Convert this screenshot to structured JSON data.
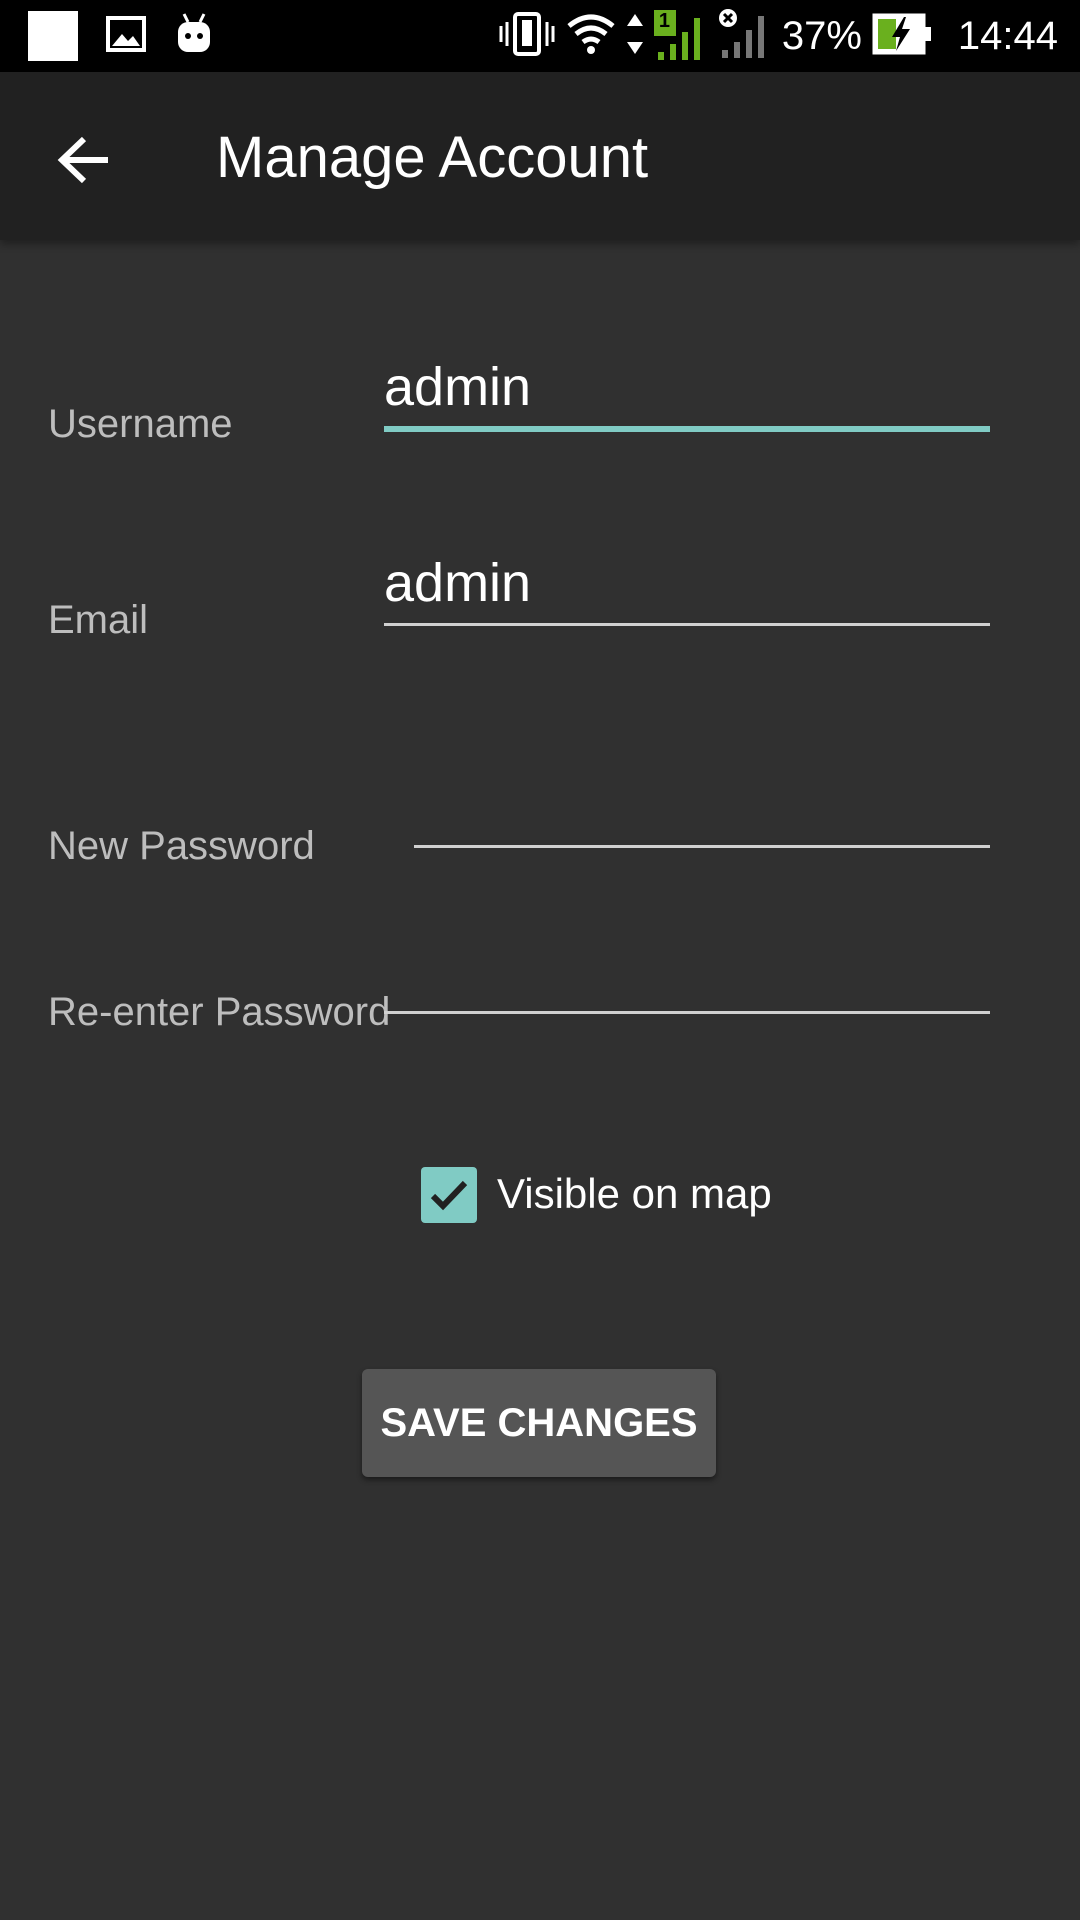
{
  "status_bar": {
    "battery_percent": "37%",
    "time": "14:44",
    "sim_label": "1",
    "icons": [
      "notification-square-icon",
      "image-icon",
      "android-icon",
      "vibrate-icon",
      "wifi-icon",
      "data-arrows-icon",
      "signal-sim1-icon",
      "signal-sim2-icon",
      "battery-charging-icon"
    ],
    "colors": {
      "signal_active": "#6ab01e",
      "battery_charge": "#6ab01e"
    }
  },
  "app_bar": {
    "title": "Manage Account",
    "back_icon": "arrow-back-icon"
  },
  "form": {
    "username": {
      "label": "Username",
      "value": "admin"
    },
    "email": {
      "label": "Email",
      "value": "admin"
    },
    "new_password": {
      "label": "New Password",
      "value": ""
    },
    "reenter_password": {
      "label": "Re-enter Password",
      "value": ""
    },
    "visible_on_map": {
      "label": "Visible on map",
      "checked": true
    },
    "save_button": "SAVE CHANGES"
  },
  "colors": {
    "background": "#303030",
    "app_bar": "#212121",
    "accent": "#80cbc4",
    "button": "#555555"
  }
}
